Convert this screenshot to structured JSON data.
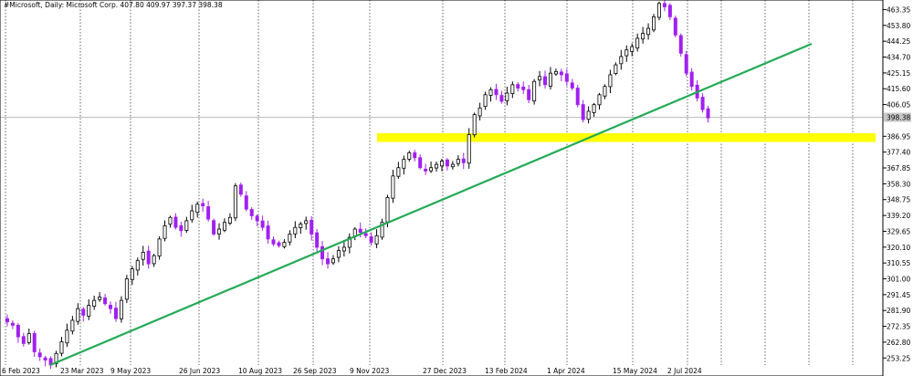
{
  "header": {
    "text": "#Microsoft, Daily:  Microsoft Corp.   407.80 409.97 397.37 398.38"
  },
  "chart_data": {
    "type": "candlestick",
    "symbol": "#Microsoft",
    "timeframe": "Daily",
    "instrument": "Microsoft Corp.",
    "ohlc_last": {
      "open": 407.8,
      "high": 409.97,
      "low": 397.37,
      "close": 398.38
    },
    "current_price_label": "398.38",
    "x_ticks": [
      "6 Feb 2023",
      "23 Mar 2023",
      "9 May 2023",
      "26 Jun 2023",
      "10 Aug 2023",
      "26 Sep 2023",
      "9 Nov 2023",
      "27 Dec 2023",
      "13 Feb 2024",
      "1 Apr 2024",
      "15 May 2024",
      "2 Jul 2024"
    ],
    "y_ticks": [
      "463.35",
      "453.80",
      "444.25",
      "434.70",
      "425.15",
      "415.60",
      "406.05",
      "386.95",
      "377.40",
      "367.85",
      "358.30",
      "348.75",
      "339.20",
      "329.65",
      "320.10",
      "310.55",
      "301.00",
      "291.45",
      "281.90",
      "272.35",
      "262.80",
      "253.25"
    ],
    "ylim": [
      249.0,
      468.0
    ],
    "bar_count": 130,
    "colors": {
      "up": "#000000",
      "down": "#a020f0",
      "trendline": "#22aa55",
      "zone": "#ffff00",
      "price_line": "#c0c0c0"
    },
    "closes": [
      275,
      273,
      266,
      262,
      268,
      257,
      254,
      252,
      249,
      256,
      263,
      270,
      276,
      283,
      279,
      285,
      288,
      290,
      286,
      283,
      277,
      288,
      301,
      307,
      312,
      317,
      310,
      315,
      325,
      333,
      338,
      332,
      330,
      336,
      342,
      346,
      345,
      337,
      328,
      331,
      335,
      338,
      357,
      352,
      343,
      339,
      336,
      332,
      325,
      322,
      321,
      323,
      328,
      332,
      334,
      336,
      328,
      320,
      313,
      310,
      313,
      318,
      320,
      326,
      331,
      329,
      327,
      323,
      327,
      335,
      350,
      363,
      368,
      373,
      377,
      374,
      368,
      366,
      368,
      370,
      372,
      369,
      370,
      373,
      371,
      388,
      400,
      404,
      412,
      415,
      412,
      408,
      413,
      418,
      416,
      415,
      409,
      420,
      423,
      418,
      425,
      426,
      424,
      420,
      416,
      406,
      397,
      402,
      406,
      412,
      417,
      424,
      430,
      435,
      439,
      441,
      446,
      449,
      452,
      459,
      467,
      465,
      459,
      448,
      437,
      425,
      417,
      410,
      403,
      398
    ],
    "trendline": {
      "start": {
        "date": "6 Feb 2023",
        "price": 249.0
      },
      "label": ""
    },
    "zone": {
      "price_low": 383.5,
      "price_high": 388.8,
      "from_date": "9 Nov 2023"
    },
    "grid": "vertical dotted lines at each date tick"
  }
}
